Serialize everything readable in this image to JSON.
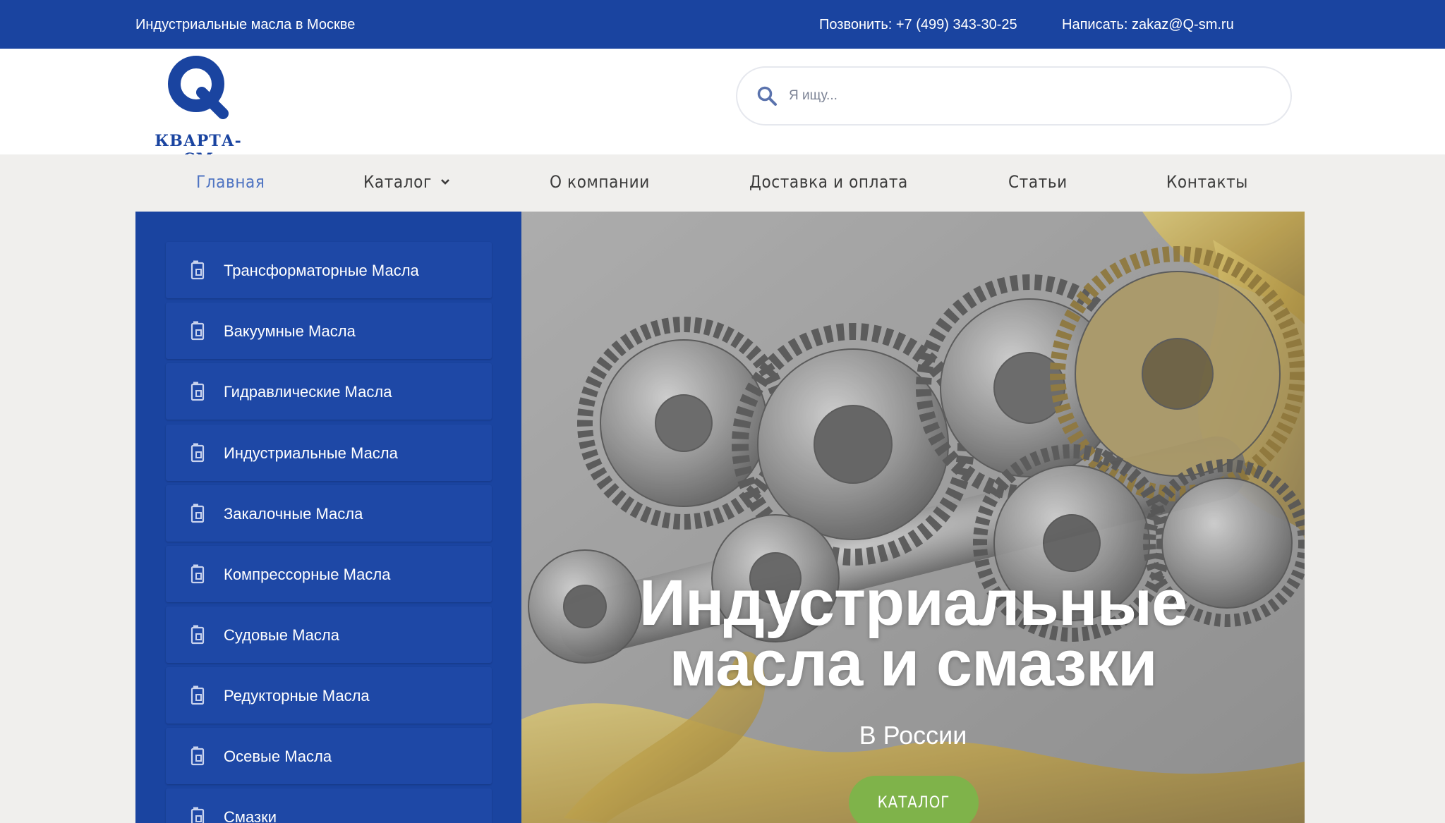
{
  "topbar": {
    "city": "Индустриальные масла в Москве",
    "phone": "Позвонить: +7 (499) 343-30-25",
    "email": "Написать: zakaz@Q-sm.ru"
  },
  "header": {
    "logo_text": "КВАРТА-СМ",
    "search_placeholder": "Я ищу..."
  },
  "nav": [
    {
      "label": "Главная",
      "active": true
    },
    {
      "label": "Каталог",
      "has_dropdown": true
    },
    {
      "label": "О компании"
    },
    {
      "label": "Доставка и оплата"
    },
    {
      "label": "Статьи"
    },
    {
      "label": "Контакты"
    }
  ],
  "sidebar": {
    "icon": "oil-canister-icon",
    "items": [
      {
        "label": "Трансформаторные Масла"
      },
      {
        "label": "Вакуумные Масла"
      },
      {
        "label": "Гидравлические Масла"
      },
      {
        "label": "Индустриальные Масла"
      },
      {
        "label": "Закалочные Масла"
      },
      {
        "label": "Компрессорные Масла"
      },
      {
        "label": "Судовые Масла"
      },
      {
        "label": "Редукторные Масла"
      },
      {
        "label": "Осевые Масла"
      },
      {
        "label": "Смазки"
      }
    ]
  },
  "hero": {
    "title_line1": "Индустриальные",
    "title_line2": "масла и смазки",
    "subtitle": "В России",
    "button_label": "КАТАЛОГ"
  },
  "colors": {
    "brand_blue": "#1a44a0",
    "nav_active": "#4f74c2",
    "button_green": "#7fb34a",
    "page_bg": "#f0efed"
  }
}
